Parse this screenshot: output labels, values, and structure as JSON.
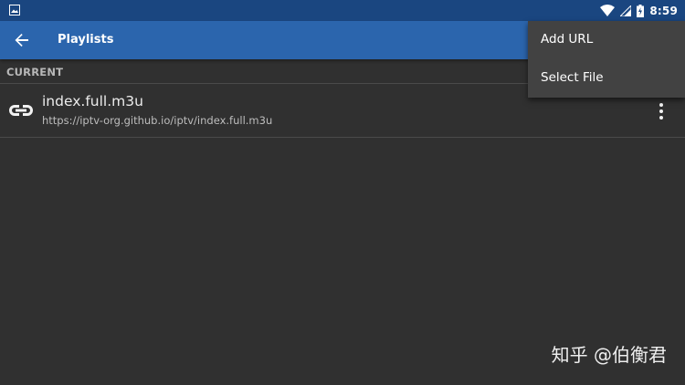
{
  "status_bar": {
    "time": "8:59",
    "icons": [
      "image-icon",
      "wifi-icon",
      "signal-icon",
      "battery-charging-icon"
    ]
  },
  "app_bar": {
    "title": "Playlists",
    "back_icon": "arrow-back-icon",
    "color": "#2b65ad"
  },
  "section": {
    "header": "CURRENT"
  },
  "playlists": [
    {
      "name": "index.full.m3u",
      "url": "https://iptv-org.github.io/iptv/index.full.m3u",
      "icon": "link-icon",
      "more_icon": "more-vert-icon"
    }
  ],
  "menu": {
    "items": [
      {
        "label": "Add URL"
      },
      {
        "label": "Select File"
      }
    ]
  },
  "watermark": "知乎 @伯衡君",
  "colors": {
    "status_bar": "#1a4680",
    "app_bar": "#2b65ad",
    "background": "#303030",
    "menu": "#424242"
  }
}
